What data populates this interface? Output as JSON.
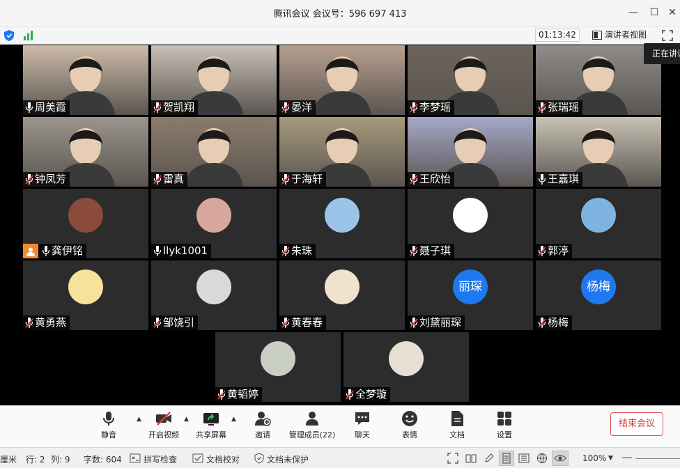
{
  "window": {
    "title": "腾讯会议 会议号：596 697 413",
    "minimize": "—",
    "maximize": "☐",
    "close": "✕"
  },
  "status": {
    "timer": "01:13:42",
    "speaker_view": "演讲者视图",
    "speaking_tip": "正在讲话"
  },
  "participants": [
    {
      "name": "周美霞",
      "mic": "on",
      "kind": "video",
      "bg": "#cdbba8"
    },
    {
      "name": "贺凯翔",
      "mic": "muted",
      "kind": "video",
      "bg": "#c9c1b6"
    },
    {
      "name": "晏洋",
      "mic": "muted",
      "kind": "video",
      "bg": "#b8a08f"
    },
    {
      "name": "李梦瑶",
      "mic": "muted",
      "kind": "video",
      "bg": "#6c6459"
    },
    {
      "name": "张瑞瑶",
      "mic": "muted",
      "kind": "video",
      "bg": "#8f8d89"
    },
    {
      "name": "钟凤芳",
      "mic": "muted",
      "kind": "video",
      "bg": "#9b958d"
    },
    {
      "name": "雷真",
      "mic": "muted",
      "kind": "video",
      "bg": "#8c7b6b"
    },
    {
      "name": "于海轩",
      "mic": "muted",
      "kind": "video",
      "bg": "#a79a7c"
    },
    {
      "name": "王欣怡",
      "mic": "muted",
      "kind": "video",
      "bg": "#a6a8c9"
    },
    {
      "name": "王嘉琪",
      "mic": "on",
      "kind": "video",
      "bg": "#c8c2b5"
    },
    {
      "name": "龚伊铭",
      "mic": "on",
      "kind": "avatar",
      "host": true,
      "avatar_color": "#8a4b3a"
    },
    {
      "name": "llyk1001",
      "mic": "on",
      "kind": "avatar",
      "avatar_color": "#d8a79c"
    },
    {
      "name": "朱珠",
      "mic": "muted",
      "kind": "avatar",
      "avatar_color": "#9cc3e8"
    },
    {
      "name": "聂子琪",
      "mic": "muted",
      "kind": "avatar",
      "avatar_color": "#ffffff"
    },
    {
      "name": "郭渟",
      "mic": "muted",
      "kind": "avatar",
      "avatar_color": "#7fb3e0"
    },
    {
      "name": "黄勇燕",
      "mic": "muted",
      "kind": "avatar",
      "avatar_color": "#f6e39b"
    },
    {
      "name": "邹饶引",
      "mic": "muted",
      "kind": "avatar",
      "avatar_color": "#d9d9d9"
    },
    {
      "name": "黄春春",
      "mic": "muted",
      "kind": "avatar",
      "avatar_color": "#f1e1cf"
    },
    {
      "name": "刘黛丽琛",
      "mic": "muted",
      "kind": "text",
      "avatar_text": "丽琛"
    },
    {
      "name": "杨梅",
      "mic": "muted",
      "kind": "text",
      "avatar_text": "杨梅"
    },
    {
      "name": "黄韬婷",
      "mic": "muted",
      "kind": "avatar",
      "avatar_color": "#c9cfc4"
    },
    {
      "name": "全梦璇",
      "mic": "muted",
      "kind": "avatar",
      "avatar_color": "#e8dfd3"
    }
  ],
  "toolbar": {
    "mute": "静音",
    "video": "开启视频",
    "share": "共享屏幕",
    "invite": "邀请",
    "members": "管理成员(22)",
    "chat": "聊天",
    "reactions": "表情",
    "docs": "文档",
    "settings": "设置",
    "end": "结束会议"
  },
  "wordbar": {
    "unit": "厘米",
    "row": "行: 2",
    "col": "列: 9",
    "words": "字数: 604",
    "spellcheck": "拼写检查",
    "proofread": "文档校对",
    "protect": "文档未保护",
    "zoom": "100%"
  },
  "colors": {
    "accent_blue": "#1e78f0",
    "end_red": "#d73a3a",
    "muted_red": "#e23b3b",
    "host_orange": "#f08a2c"
  }
}
